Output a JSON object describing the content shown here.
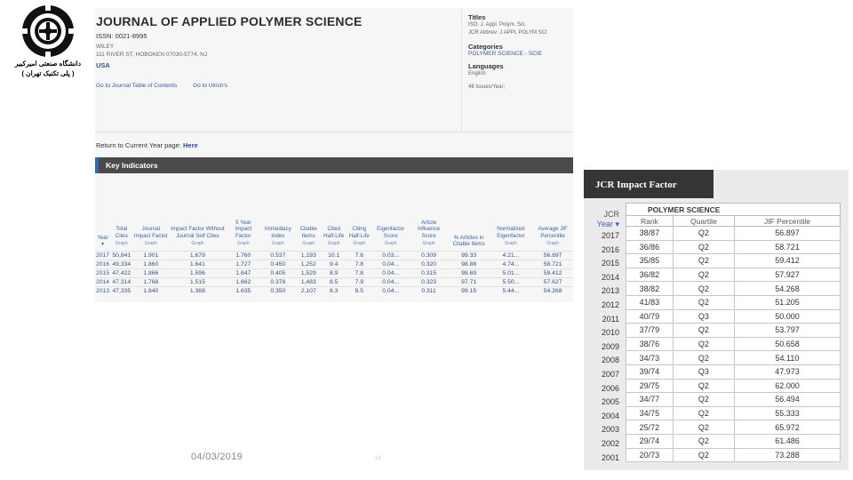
{
  "logo": {
    "text_line1": "دانشگاه صنعتی امیرکبیر",
    "text_line2": "( پلی تکنیک تهران )",
    "icon": "university-seal-icon"
  },
  "journal": {
    "title": "JOURNAL OF APPLIED POLYMER SCIENCE",
    "issn": "ISSN: 0021-8995",
    "publisher": "WILEY",
    "address": "111 RIVER ST, HOBOKEN 07030-5774, NJ",
    "country": "USA",
    "link_toc": "Go to Journal Table of Contents",
    "link_ulrich": "Go to Ulrich's",
    "titles_heading": "Titles",
    "titles_line1": "ISO: J. Appl. Polym. Sci.",
    "titles_line2": "JCR Abbrev: J APPL POLYM SCI",
    "categories_heading": "Categories",
    "category": "POLYMER SCIENCE - SCIE",
    "languages_heading": "Languages",
    "language": "English",
    "issues": "48 Issues/Year;",
    "return_label": "Return to Current Year page:",
    "return_link": "Here",
    "key_indicators": "Key Indicators"
  },
  "key_table": {
    "headers": [
      "Year",
      "Total Cites",
      "Journal Impact Factor",
      "Impact Factor Without Journal Self Cites",
      "5 Year Impact Factor",
      "Immediacy Index",
      "Citable Items",
      "Cited Half-Life",
      "Citing Half-Life",
      "Eigenfactor Score",
      "Article Influence Score",
      "% Articles in Citable Items",
      "Normalized Eigenfactor",
      "Average JIF Percentile"
    ],
    "graph_label": "Graph",
    "sort_icon": "sort-desc-icon",
    "rows": [
      [
        "2017",
        "50,841",
        "1.901",
        "1.679",
        "1.760",
        "0.537",
        "1,193",
        "10.1",
        "7.6",
        "0.03...",
        "0.309",
        "99.33",
        "4.21...",
        "56.897"
      ],
      [
        "2016",
        "49,334",
        "1.860",
        "1.641",
        "1.727",
        "0.450",
        "1,252",
        "9.4",
        "7.8",
        "0.04...",
        "0.320",
        "98.88",
        "4.74...",
        "58.721"
      ],
      [
        "2015",
        "47,422",
        "1.866",
        "1.596",
        "1.647",
        "0.405",
        "1,529",
        "8.9",
        "7.8",
        "0.04...",
        "0.315",
        "98.69",
        "5.01...",
        "59.412"
      ],
      [
        "2014",
        "47,314",
        "1.768",
        "1.515",
        "1.662",
        "0.378",
        "1,483",
        "8.5",
        "7.9",
        "0.04...",
        "0.323",
        "97.71",
        "5.50...",
        "57.627"
      ],
      [
        "2013",
        "47,335",
        "1.640",
        "1.368",
        "1.635",
        "0.350",
        "2,107",
        "8.3",
        "8.5",
        "0.04...",
        "0.311",
        "99.15",
        "5.44...",
        "54.268"
      ]
    ]
  },
  "footer": {
    "date": "04/03/2019",
    "page": "14"
  },
  "jcr": {
    "title": "JCR Impact Factor",
    "sub_label_line1": "JCR",
    "sub_label_line2": "Year",
    "category": "POLYMER SCIENCE",
    "columns": [
      "Rank",
      "Quartile",
      "JIF Percentile"
    ],
    "rows": [
      {
        "year": "2017",
        "rank": "38/87",
        "quartile": "Q2",
        "percentile": "56.897"
      },
      {
        "year": "2016",
        "rank": "36/86",
        "quartile": "Q2",
        "percentile": "58.721"
      },
      {
        "year": "2015",
        "rank": "35/85",
        "quartile": "Q2",
        "percentile": "59.412"
      },
      {
        "year": "2014",
        "rank": "36/82",
        "quartile": "Q2",
        "percentile": "57.927"
      },
      {
        "year": "2013",
        "rank": "38/82",
        "quartile": "Q2",
        "percentile": "54.268"
      },
      {
        "year": "2012",
        "rank": "41/83",
        "quartile": "Q2",
        "percentile": "51.205"
      },
      {
        "year": "2011",
        "rank": "40/79",
        "quartile": "Q3",
        "percentile": "50.000"
      },
      {
        "year": "2010",
        "rank": "37/79",
        "quartile": "Q2",
        "percentile": "53.797"
      },
      {
        "year": "2009",
        "rank": "38/76",
        "quartile": "Q2",
        "percentile": "50.658"
      },
      {
        "year": "2008",
        "rank": "34/73",
        "quartile": "Q2",
        "percentile": "54.110"
      },
      {
        "year": "2007",
        "rank": "39/74",
        "quartile": "Q3",
        "percentile": "47.973"
      },
      {
        "year": "2006",
        "rank": "29/75",
        "quartile": "Q2",
        "percentile": "62.000"
      },
      {
        "year": "2005",
        "rank": "34/77",
        "quartile": "Q2",
        "percentile": "56.494"
      },
      {
        "year": "2004",
        "rank": "34/75",
        "quartile": "Q2",
        "percentile": "55.333"
      },
      {
        "year": "2003",
        "rank": "25/72",
        "quartile": "Q2",
        "percentile": "65.972"
      },
      {
        "year": "2002",
        "rank": "29/74",
        "quartile": "Q2",
        "percentile": "61.486"
      },
      {
        "year": "2001",
        "rank": "20/73",
        "quartile": "Q2",
        "percentile": "73.288"
      }
    ]
  }
}
